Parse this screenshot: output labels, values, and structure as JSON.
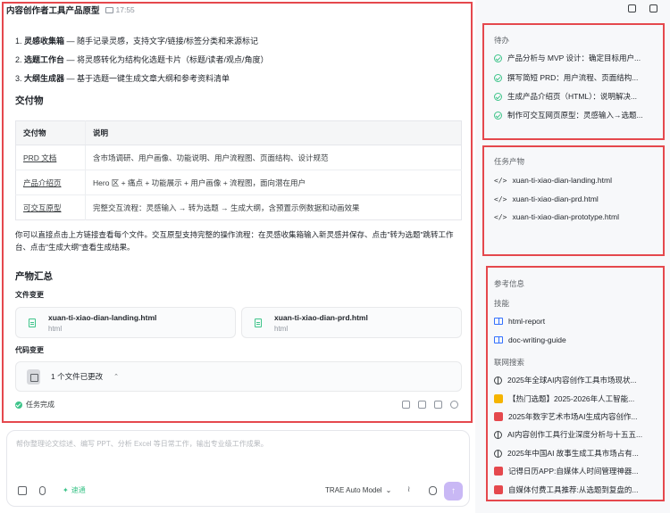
{
  "header": {
    "title": "内容创作者工具产品原型",
    "time": "17:55"
  },
  "features": [
    {
      "num": "1.",
      "name": "灵感收集箱",
      "desc": " — 随手记录灵感，支持文字/链接/标签分类和来源标记"
    },
    {
      "num": "2.",
      "name": "选题工作台",
      "desc": " — 将灵感转化为结构化选题卡片（标题/读者/观点/角度）"
    },
    {
      "num": "3.",
      "name": "大纲生成器",
      "desc": " — 基于选题一键生成文章大纲和参考资料清单"
    }
  ],
  "deliverables": {
    "heading": "交付物",
    "columns": [
      "交付物",
      "说明"
    ],
    "rows": [
      {
        "name": "PRD 文档",
        "desc": "含市场调研、用户画像、功能说明、用户流程图、页面结构、设计规范"
      },
      {
        "name": "产品介绍页",
        "desc": "Hero 区 + 痛点 + 功能展示 + 用户画像 + 流程图，面向潜在用户"
      },
      {
        "name": "可交互原型",
        "desc": "完整交互流程：灵感输入 → 转为选题 → 生成大纲，含预置示例数据和动画效果"
      }
    ]
  },
  "paragraph": "你可以直接点击上方链接查看每个文件。交互原型支持完整的操作流程：在灵感收集箱输入新灵感并保存、点击\"转为选题\"跳转工作台、点击\"生成大纲\"查看生成结果。",
  "summary": {
    "heading": "产物汇总",
    "files_label": "文件变更",
    "files": [
      {
        "name": "xuan-ti-xiao-dian-landing.html",
        "type": "html"
      },
      {
        "name": "xuan-ti-xiao-dian-prd.html",
        "type": "html"
      }
    ],
    "code_label": "代码变更",
    "code_change": "1 个文件已更改",
    "status": "任务完成"
  },
  "composer": {
    "placeholder": "帮你整理论文综述、编写 PPT、分析 Excel 等日常工作，输出专业级工作成果。",
    "speed": "速通",
    "model": "TRAE Auto Model"
  },
  "todo": {
    "title": "待办",
    "items": [
      "产品分析与 MVP 设计：确定目标用户...",
      "撰写简短 PRD：用户流程、页面结构...",
      "生成产品介绍页（HTML）：说明解决...",
      "制作可交互网页原型：灵感输入→选题..."
    ]
  },
  "artifacts": {
    "title": "任务产物",
    "items": [
      "xuan-ti-xiao-dian-landing.html",
      "xuan-ti-xiao-dian-prd.html",
      "xuan-ti-xiao-dian-prototype.html"
    ]
  },
  "reference": {
    "title": "参考信息",
    "skills_label": "技能",
    "skills": [
      "html-report",
      "doc-writing-guide"
    ],
    "web_label": "联网搜索",
    "web": [
      {
        "text": "2025年全球AI内容创作工具市场现状...",
        "icon": "globe-icon",
        "color": "#3c4043"
      },
      {
        "text": "【热门选题】2025-2026年人工智能...",
        "icon": "site-favicon",
        "color": "#f5b400"
      },
      {
        "text": "2025年数字艺术市场AI生成内容创作...",
        "icon": "site-favicon",
        "color": "#e5484d"
      },
      {
        "text": "AI内容创作工具行业深度分析与十五五...",
        "icon": "globe-icon",
        "color": "#3c4043"
      },
      {
        "text": "2025年中国AI 故事生成工具市场占有...",
        "icon": "globe-icon",
        "color": "#3c4043"
      },
      {
        "text": "记得日历APP:自媒体人时间管理神器...",
        "icon": "site-favicon",
        "color": "#e5484d"
      },
      {
        "text": "自媒体付费工具推荐:从选题到复盘的...",
        "icon": "site-favicon",
        "color": "#e5484d"
      }
    ]
  },
  "colors": {
    "accent": "#3ec48a",
    "highlight": "#e5484d",
    "send": "#c9b8f5"
  }
}
